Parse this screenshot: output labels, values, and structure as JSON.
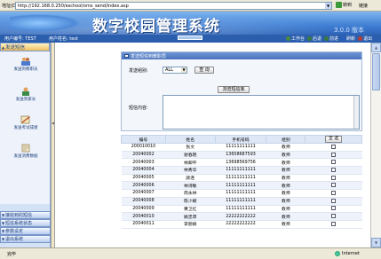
{
  "browser": {
    "address_label": "地址(D)",
    "url": "http://192.168.0.250/eschool/sms_send/index.asp",
    "go_label": "转到",
    "links_label": "链接"
  },
  "banner": {
    "title": "数字校园管理系统",
    "version": "3.0.0 版本"
  },
  "userbar": {
    "user_id": "用户编号: TEST",
    "user_name": "用户姓名: test",
    "tools": [
      {
        "icon": "desk-icon",
        "label": "工作台",
        "color": "#4a8a3a"
      },
      {
        "icon": "back-icon",
        "label": "后退",
        "color": "#3a7a3a"
      },
      {
        "icon": "forward-icon",
        "label": "前进",
        "color": "#3a7a3a"
      },
      {
        "icon": "refresh-icon",
        "label": "刷新",
        "color": "#2a60c0"
      },
      {
        "icon": "exit-icon",
        "label": "退出",
        "color": "#c03a2a"
      }
    ]
  },
  "sidebar": {
    "top_head": "发送短信",
    "items": [
      {
        "label": "发送到教职员",
        "icon": "faculty-icon"
      },
      {
        "label": "发送到家长",
        "icon": "parent-icon"
      },
      {
        "label": "发送考试成绩",
        "icon": "exam-icon"
      },
      {
        "label": "发送消费数据",
        "icon": "consume-icon"
      }
    ],
    "bottom_heads": [
      "接收到的短信",
      "短信系统状态",
      "参数设定",
      "退出系统"
    ]
  },
  "panel": {
    "title": "发送短信到教职员",
    "group_label": "发送组别:",
    "group_value": "ALL",
    "query_btn": "查 询",
    "browse_btn": "浏览短信库",
    "content_label": "短信内容:"
  },
  "table": {
    "headers": [
      "编号",
      "姓名",
      "手机号码",
      "组别"
    ],
    "select_all": "全 选",
    "rows": [
      [
        "200010010",
        "张文",
        "11111111111",
        "教师"
      ],
      [
        "20040002",
        "谢春艳",
        "13658687593",
        "教师"
      ],
      [
        "20040003",
        "林卿平",
        "13698569756",
        "教师"
      ],
      [
        "20040004",
        "林秀华",
        "11111111111",
        "教师"
      ],
      [
        "20040005",
        "颜连",
        "11111111111",
        "教师"
      ],
      [
        "20040006",
        "林诗敏",
        "11111111111",
        "教师"
      ],
      [
        "20040007",
        "周永林",
        "11111111111",
        "教师"
      ],
      [
        "20040008",
        "陈少娴",
        "11111111111",
        "教师"
      ],
      [
        "20040009",
        "黄卫红",
        "11111111111",
        "教师"
      ],
      [
        "20040010",
        "姚忠萍",
        "22222222222",
        "教师"
      ],
      [
        "20040011",
        "李丽娟",
        "22222222222",
        "教师"
      ]
    ]
  },
  "status": {
    "done": "完毕",
    "zone": "Internet"
  }
}
